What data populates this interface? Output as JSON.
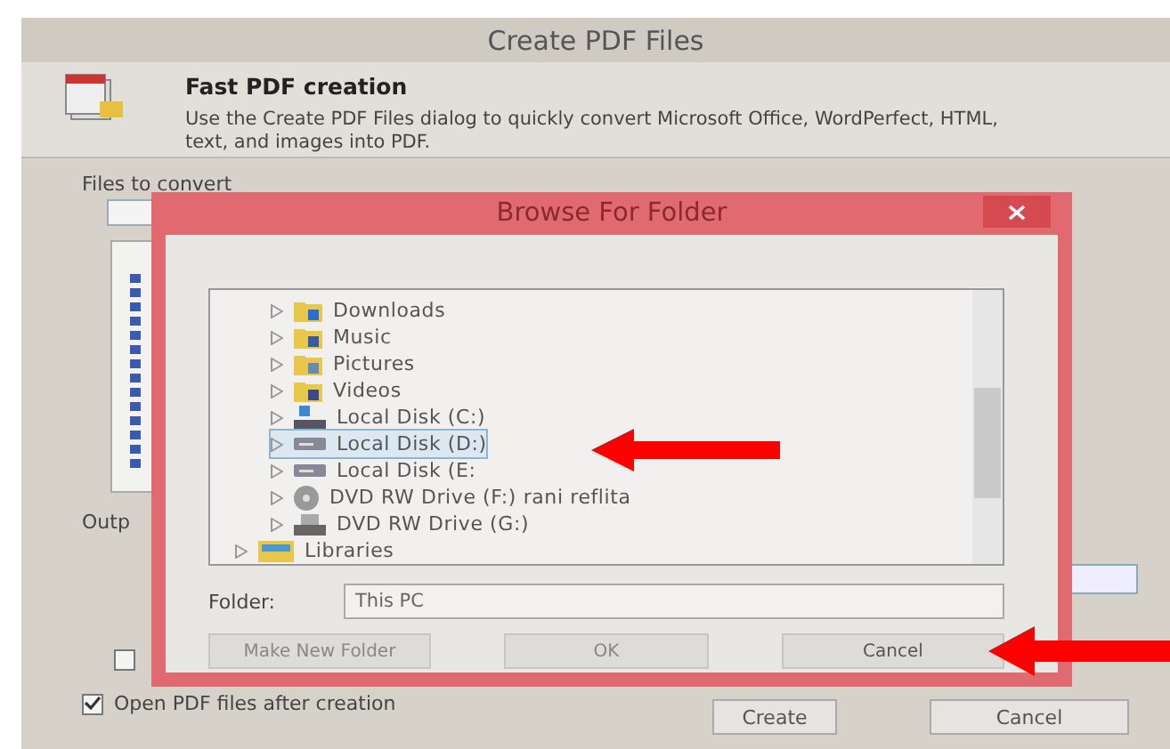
{
  "window": {
    "title": "Create PDF Files"
  },
  "header": {
    "title": "Fast PDF creation",
    "description": "Use the Create PDF Files dialog to quickly convert Microsoft Office, WordPerfect, HTML, text, and images into PDF."
  },
  "files_section": {
    "label": "Files to convert"
  },
  "output_section": {
    "label": "Outp"
  },
  "options": [
    {
      "checked": false
    },
    {
      "label": "Open PDF files after creation",
      "checked": true
    }
  ],
  "buttons": [
    "Create",
    "Cancel"
  ],
  "browse_dialog": {
    "title": "Browse For Folder",
    "tree": [
      {
        "children": [
          {
            "label": "Downloads",
            "kind": "downloads",
            "selected": false
          },
          {
            "label": "Music",
            "kind": "music",
            "selected": false
          },
          {
            "label": "Pictures",
            "kind": "pictures",
            "selected": false
          },
          {
            "label": "Videos",
            "kind": "videos",
            "selected": false
          },
          {
            "label": "Local Disk (C:)",
            "kind": "system-disk",
            "selected": false
          },
          {
            "label": "Local Disk (D:)",
            "kind": "disk",
            "selected": true
          },
          {
            "label": "Local Disk (E:",
            "kind": "disk",
            "selected": false
          },
          {
            "label": "DVD RW Drive (F:) rani reflita",
            "kind": "disc",
            "selected": false
          },
          {
            "label": "DVD RW Drive (G:)",
            "kind": "drive",
            "selected": false
          }
        ]
      },
      {
        "label": "Libraries",
        "kind": "library",
        "selected": false
      }
    ],
    "folder": {
      "label": "Folder:",
      "value": "This PC"
    },
    "buttons": [
      {
        "label": "Make New Folder",
        "disabled": true
      },
      {
        "label": "OK",
        "disabled": true
      },
      {
        "label": "Cancel",
        "disabled": false
      }
    ]
  }
}
